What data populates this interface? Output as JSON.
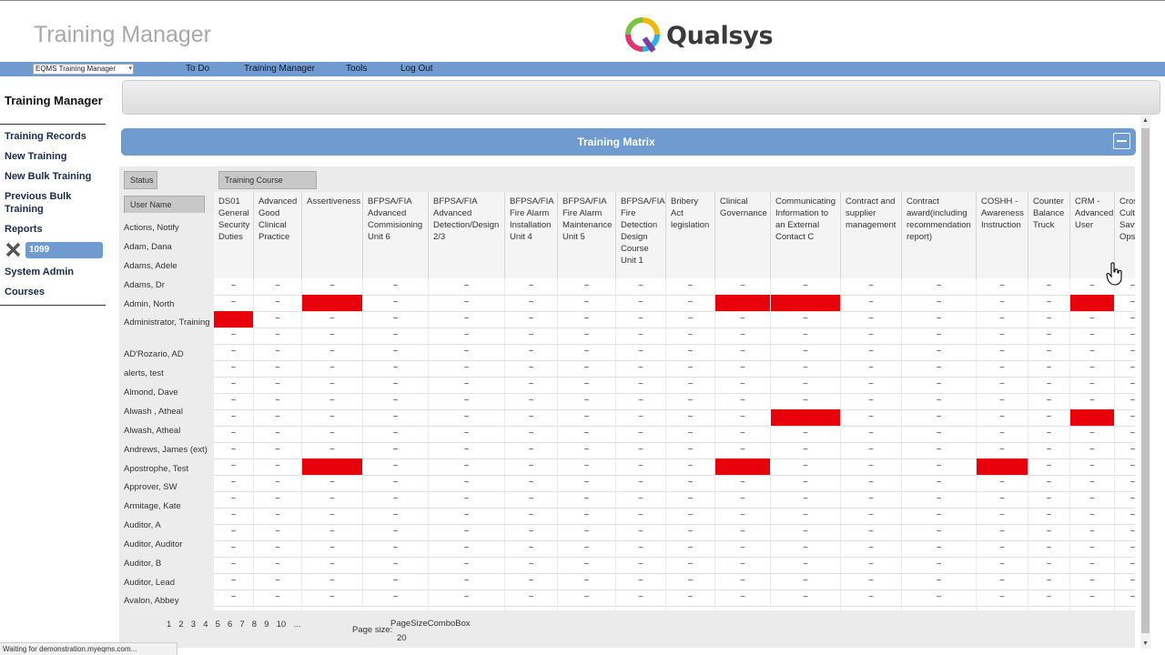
{
  "header": {
    "app_title": "Training Manager",
    "logo_text": "Qualsys"
  },
  "navbar": {
    "select_value": "EQMS Training Manager",
    "links": [
      "To Do",
      "Training Manager",
      "Tools",
      "Log Out"
    ]
  },
  "sidebar": {
    "title": "Training Manager",
    "items": [
      "Training Records",
      "New Training",
      "New Bulk Training",
      "Previous Bulk Training",
      "Reports"
    ],
    "chip_label": "1099",
    "items2": [
      "System Admin",
      "Courses"
    ]
  },
  "matrix": {
    "panel_title": "Training Matrix",
    "status_grip": "Status",
    "user_grip": "User Name",
    "course_grip": "Training Course",
    "columns": [
      "DS01 General Security Duties",
      "Advanced Good Clinical Practice",
      "Assertiveness",
      "BFPSA/FIA Advanced Commisioning Unit 6",
      "BFPSA/FIA Advanced Detection/Design 2/3",
      "BFPSA/FIA Fire Alarm Installation Unit 4",
      "BFPSA/FIA Fire Alarm Maintenance Unit 5",
      "BFPSA/FIA Fire Detection Design Course Unit 1",
      "Bribery Act legislation",
      "Clinical Governance",
      "Communicating Information to an External Contact C",
      "Contract and supplier management",
      "Contract award(including recommendation report)",
      "COSHH - Awareness Instruction",
      "Counter Balance Truck",
      "CRM - Advanced User",
      "Cross Cultural Savvy Ops"
    ],
    "users": [
      "Actions, Notify",
      "Adam, Dana",
      "Adams, Adele",
      "Adams, Dr",
      "Admin, North",
      "Administrator, Training",
      "AD'Rozario, AD",
      "alerts, test",
      "Almond, Dave",
      "Alwash , Atheal",
      "Alwash, Atheal",
      "Andrews, James (ext)",
      "Apostrophe, Test",
      "Approver, SW",
      "Armitage, Kate",
      "Auditor, A",
      "Auditor, Auditor",
      "Auditor, B",
      "Auditor, Lead",
      "Avalon, Abbey"
    ],
    "cell_symbol": "~",
    "red_cells": [
      [
        1,
        2
      ],
      [
        1,
        9
      ],
      [
        1,
        10
      ],
      [
        1,
        15
      ],
      [
        2,
        0
      ],
      [
        8,
        10
      ],
      [
        8,
        15
      ],
      [
        11,
        2
      ],
      [
        11,
        9
      ],
      [
        11,
        13
      ]
    ],
    "colors": {
      "overdue": "#e8000b",
      "accent": "#6f9bd0"
    }
  },
  "pager": {
    "pages": [
      "1",
      "2",
      "3",
      "4",
      "5",
      "6",
      "7",
      "8",
      "9",
      "10",
      "..."
    ],
    "page_size_label": "Page size:",
    "page_size_combo": "PageSizeComboBox",
    "page_size_value": "20"
  },
  "status_bar": {
    "text": "Waiting for demonstration.myeqms.com..."
  }
}
